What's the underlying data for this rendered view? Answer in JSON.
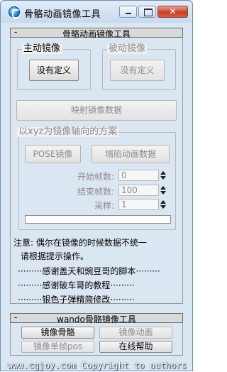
{
  "window": {
    "title": "骨骼动画镜像工具",
    "buttons": {
      "minimize": "",
      "maximize": "",
      "close": "✕"
    }
  },
  "rollout1": {
    "collapse": "-",
    "title": "骨骼动画镜像工具",
    "active_mirror": {
      "label": "主动镜像",
      "button": "没有定义"
    },
    "passive_mirror": {
      "label": "被动镜像",
      "button": "没有定义"
    },
    "map_button": "映射镜像数据",
    "axis_group": {
      "label": "以xyz为镜像轴向的方案",
      "pose_button": "POSE镜像",
      "anim_button": "塌陷动画数据",
      "start_frame": {
        "label": "开始帧数:",
        "value": "0"
      },
      "end_frame": {
        "label": "结束帧数:",
        "value": "100"
      },
      "sample": {
        "label": "采样:",
        "value": "1"
      },
      "progress": 0
    },
    "notes": [
      "注意: 偶尔在镜像的时候数据不统一",
      "请根据提示操作。",
      "·········感谢盖天和豌豆哥的脚本·········",
      "·········感谢破车哥的教程·········",
      "·········银色子弹精简修改·········"
    ]
  },
  "rollout2": {
    "collapse": "-",
    "title": "wando骨骼镜像工具",
    "buttons": {
      "mirror_bone": "镜像骨骼",
      "mirror_anim": "镜像动画",
      "mirror_single_frame": "镜像单帧pos",
      "online_help": "在线帮助"
    }
  },
  "watermark": "www.cgjoy.com  Copyright to authors"
}
